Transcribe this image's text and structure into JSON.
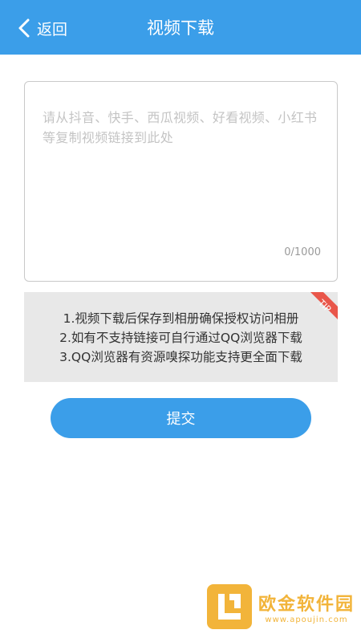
{
  "header": {
    "back_label": "返回",
    "title": "视频下载"
  },
  "input": {
    "placeholder": "请从抖音、快手、西瓜视频、好看视频、小红书等复制视频链接到此处",
    "value": "",
    "counter": "0/1000"
  },
  "tip": {
    "badge": "TIP",
    "lines": [
      "1.视频下载后保存到相册确保授权访问相册",
      "2.如有不支持链接可自行通过QQ浏览器下载",
      "3.QQ浏览器有资源嗅探功能支持更全面下载"
    ]
  },
  "submit_label": "提交",
  "watermark": {
    "title": "欧金软件园",
    "url": "www.apoujin.com"
  },
  "colors": {
    "accent": "#3b9ee9",
    "tip_badge": "#e9564a",
    "tip_bg": "#e8e8e8",
    "watermark": "#f2b43a"
  }
}
